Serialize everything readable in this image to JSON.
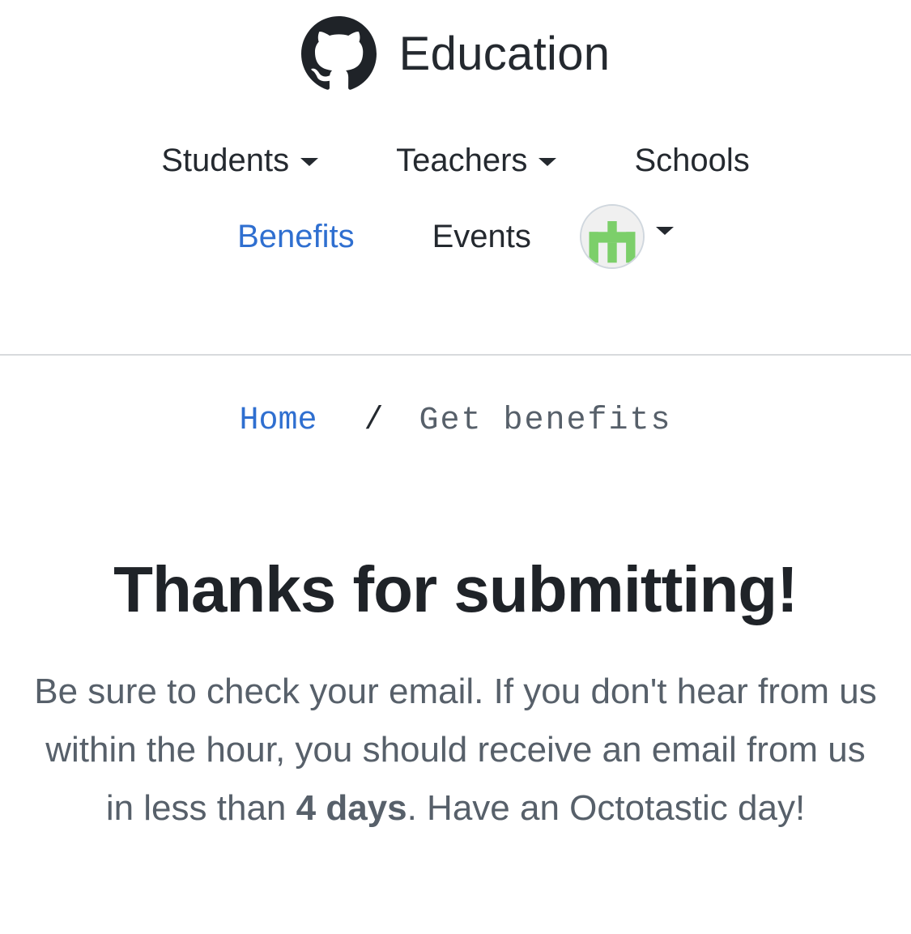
{
  "header": {
    "brand_name": "Education",
    "logo_icon": "github-octocat-icon",
    "nav": {
      "students_label": "Students",
      "teachers_label": "Teachers",
      "schools_label": "Schools",
      "benefits_label": "Benefits",
      "events_label": "Events",
      "active_item": "Benefits",
      "avatar_icon": "user-avatar-identicon"
    },
    "colors": {
      "link": "#2f6fd0",
      "text": "#24292f",
      "muted": "#57606a",
      "avatar_green": "#7ccf6a"
    }
  },
  "breadcrumb": {
    "home_label": "Home",
    "separator": "/",
    "current_label": "Get benefits"
  },
  "main": {
    "title": "Thanks for submitting!",
    "message_part1": "Be sure to check your email. If you don't hear from us within the hour, you should receive an email from us in less than ",
    "message_bold": "4 days",
    "message_part2": ". Have an Octotastic day!"
  }
}
